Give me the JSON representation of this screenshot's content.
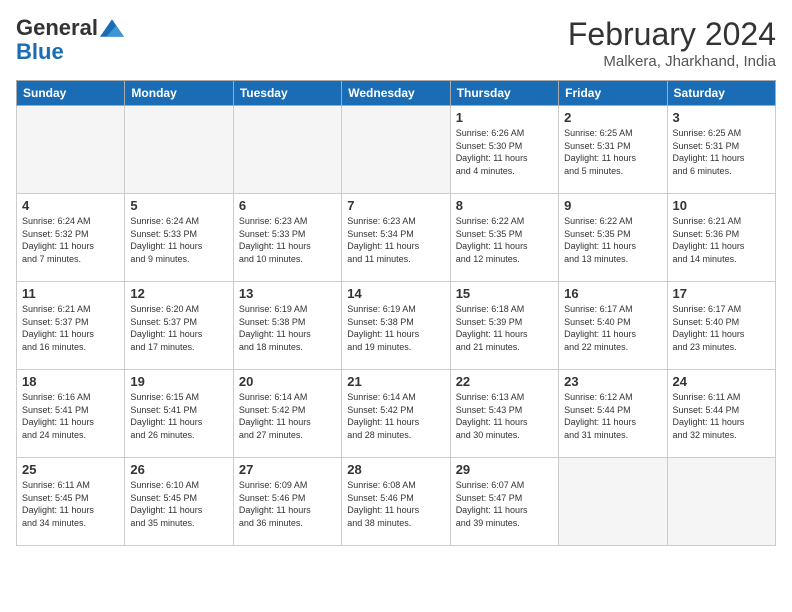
{
  "logo": {
    "line1": "General",
    "line2": "Blue"
  },
  "title": "February 2024",
  "subtitle": "Malkera, Jharkhand, India",
  "weekdays": [
    "Sunday",
    "Monday",
    "Tuesday",
    "Wednesday",
    "Thursday",
    "Friday",
    "Saturday"
  ],
  "weeks": [
    [
      {
        "day": "",
        "info": ""
      },
      {
        "day": "",
        "info": ""
      },
      {
        "day": "",
        "info": ""
      },
      {
        "day": "",
        "info": ""
      },
      {
        "day": "1",
        "info": "Sunrise: 6:26 AM\nSunset: 5:30 PM\nDaylight: 11 hours\nand 4 minutes."
      },
      {
        "day": "2",
        "info": "Sunrise: 6:25 AM\nSunset: 5:31 PM\nDaylight: 11 hours\nand 5 minutes."
      },
      {
        "day": "3",
        "info": "Sunrise: 6:25 AM\nSunset: 5:31 PM\nDaylight: 11 hours\nand 6 minutes."
      }
    ],
    [
      {
        "day": "4",
        "info": "Sunrise: 6:24 AM\nSunset: 5:32 PM\nDaylight: 11 hours\nand 7 minutes."
      },
      {
        "day": "5",
        "info": "Sunrise: 6:24 AM\nSunset: 5:33 PM\nDaylight: 11 hours\nand 9 minutes."
      },
      {
        "day": "6",
        "info": "Sunrise: 6:23 AM\nSunset: 5:33 PM\nDaylight: 11 hours\nand 10 minutes."
      },
      {
        "day": "7",
        "info": "Sunrise: 6:23 AM\nSunset: 5:34 PM\nDaylight: 11 hours\nand 11 minutes."
      },
      {
        "day": "8",
        "info": "Sunrise: 6:22 AM\nSunset: 5:35 PM\nDaylight: 11 hours\nand 12 minutes."
      },
      {
        "day": "9",
        "info": "Sunrise: 6:22 AM\nSunset: 5:35 PM\nDaylight: 11 hours\nand 13 minutes."
      },
      {
        "day": "10",
        "info": "Sunrise: 6:21 AM\nSunset: 5:36 PM\nDaylight: 11 hours\nand 14 minutes."
      }
    ],
    [
      {
        "day": "11",
        "info": "Sunrise: 6:21 AM\nSunset: 5:37 PM\nDaylight: 11 hours\nand 16 minutes."
      },
      {
        "day": "12",
        "info": "Sunrise: 6:20 AM\nSunset: 5:37 PM\nDaylight: 11 hours\nand 17 minutes."
      },
      {
        "day": "13",
        "info": "Sunrise: 6:19 AM\nSunset: 5:38 PM\nDaylight: 11 hours\nand 18 minutes."
      },
      {
        "day": "14",
        "info": "Sunrise: 6:19 AM\nSunset: 5:38 PM\nDaylight: 11 hours\nand 19 minutes."
      },
      {
        "day": "15",
        "info": "Sunrise: 6:18 AM\nSunset: 5:39 PM\nDaylight: 11 hours\nand 21 minutes."
      },
      {
        "day": "16",
        "info": "Sunrise: 6:17 AM\nSunset: 5:40 PM\nDaylight: 11 hours\nand 22 minutes."
      },
      {
        "day": "17",
        "info": "Sunrise: 6:17 AM\nSunset: 5:40 PM\nDaylight: 11 hours\nand 23 minutes."
      }
    ],
    [
      {
        "day": "18",
        "info": "Sunrise: 6:16 AM\nSunset: 5:41 PM\nDaylight: 11 hours\nand 24 minutes."
      },
      {
        "day": "19",
        "info": "Sunrise: 6:15 AM\nSunset: 5:41 PM\nDaylight: 11 hours\nand 26 minutes."
      },
      {
        "day": "20",
        "info": "Sunrise: 6:14 AM\nSunset: 5:42 PM\nDaylight: 11 hours\nand 27 minutes."
      },
      {
        "day": "21",
        "info": "Sunrise: 6:14 AM\nSunset: 5:42 PM\nDaylight: 11 hours\nand 28 minutes."
      },
      {
        "day": "22",
        "info": "Sunrise: 6:13 AM\nSunset: 5:43 PM\nDaylight: 11 hours\nand 30 minutes."
      },
      {
        "day": "23",
        "info": "Sunrise: 6:12 AM\nSunset: 5:44 PM\nDaylight: 11 hours\nand 31 minutes."
      },
      {
        "day": "24",
        "info": "Sunrise: 6:11 AM\nSunset: 5:44 PM\nDaylight: 11 hours\nand 32 minutes."
      }
    ],
    [
      {
        "day": "25",
        "info": "Sunrise: 6:11 AM\nSunset: 5:45 PM\nDaylight: 11 hours\nand 34 minutes."
      },
      {
        "day": "26",
        "info": "Sunrise: 6:10 AM\nSunset: 5:45 PM\nDaylight: 11 hours\nand 35 minutes."
      },
      {
        "day": "27",
        "info": "Sunrise: 6:09 AM\nSunset: 5:46 PM\nDaylight: 11 hours\nand 36 minutes."
      },
      {
        "day": "28",
        "info": "Sunrise: 6:08 AM\nSunset: 5:46 PM\nDaylight: 11 hours\nand 38 minutes."
      },
      {
        "day": "29",
        "info": "Sunrise: 6:07 AM\nSunset: 5:47 PM\nDaylight: 11 hours\nand 39 minutes."
      },
      {
        "day": "",
        "info": ""
      },
      {
        "day": "",
        "info": ""
      }
    ]
  ]
}
